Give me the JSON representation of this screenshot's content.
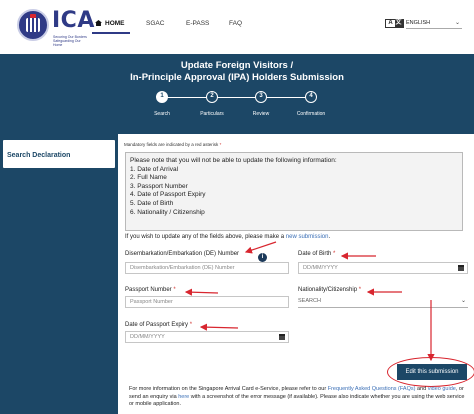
{
  "header": {
    "logo_text": "ICA",
    "logo_tagline": "Securing Our Borders Safeguarding Our Home",
    "nav": [
      {
        "label": "HOME"
      },
      {
        "label": "SGAC"
      },
      {
        "label": "E-PASS"
      },
      {
        "label": "FAQ"
      }
    ],
    "lang_icon": {
      "a": "A",
      "b": "文"
    },
    "language": "ENGLISH"
  },
  "banner": {
    "title_line1": "Update Foreign Visitors /",
    "title_line2": "In-Principle Approval (IPA) Holders Submission",
    "steps": [
      {
        "num": "1",
        "label": "Search",
        "active": true
      },
      {
        "num": "2",
        "label": "Particulars",
        "active": false
      },
      {
        "num": "3",
        "label": "Review",
        "active": false
      },
      {
        "num": "4",
        "label": "Confirmation",
        "active": false
      }
    ]
  },
  "sidebar": {
    "item": "Search Declaration"
  },
  "main": {
    "mandatory_note": "Mandatory fields are indicated by a red asterisk",
    "req_mark": "*",
    "info_lines": [
      "Please note that you will not be able to update the following information:",
      "1. Date of Arrival",
      "2. Full Name",
      "3. Passport Number",
      "4. Date of Passport Expiry",
      "5. Date of Birth",
      "6. Nationality / Citizenship"
    ],
    "update_prefix": "If you wish to update any of the fields above, please make a ",
    "update_link": "new submission",
    "update_suffix": ".",
    "fields": {
      "de_number": {
        "label": "Disembarkation/Embarkation (DE) Number",
        "placeholder": "Disembarkation/Embarkation (DE) Number",
        "info": "i"
      },
      "dob": {
        "label": "Date of Birth",
        "placeholder": "DD/MM/YYYY"
      },
      "passport": {
        "label": "Passport Number",
        "placeholder": "Passport Number"
      },
      "nationality": {
        "label": "Nationality/Citizenship",
        "placeholder": "SEARCH"
      },
      "passport_expiry": {
        "label": "Date of Passport Expiry",
        "placeholder": "DD/MM/YYYY"
      }
    },
    "edit_button": "Edit this submission",
    "footer_prefix": "For more information on the Singapore Arrival Card e-Service, please refer to our ",
    "footer_link1": "Frequently Asked Questions (FAQs)",
    "footer_mid1": " and ",
    "footer_link2": "video guide",
    "footer_mid2": ", or send an enquiry via ",
    "footer_link3": "here",
    "footer_suffix": " with a screenshot of the error message (if available). Please also indicate whether you are using the web service or mobile application."
  },
  "colors": {
    "primary": "#1c4766",
    "accent_red": "#d8262f",
    "link": "#3b6fb6"
  }
}
